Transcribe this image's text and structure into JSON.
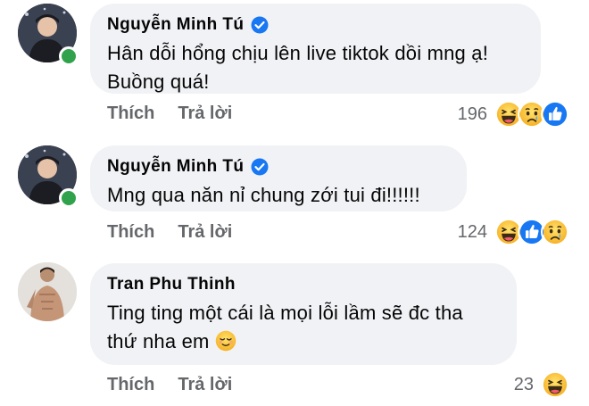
{
  "comments": [
    {
      "author": "Nguyễn Minh Tú",
      "verified": true,
      "text_lines": [
        "Hân dỗi hổng chịu lên live tiktok dồi mng ạ!",
        "Buồng quá!"
      ],
      "actions": {
        "like": "Thích",
        "reply": "Trả lời"
      },
      "reaction_count": "196",
      "reactions": [
        "haha-icon",
        "sad-icon",
        "like-icon"
      ],
      "online": true
    },
    {
      "author": "Nguyễn Minh Tú",
      "verified": true,
      "text_lines": [
        "Mng qua năn nỉ chung zới tui đi!!!!!!"
      ],
      "actions": {
        "like": "Thích",
        "reply": "Trả lời"
      },
      "reaction_count": "124",
      "reactions": [
        "haha-icon",
        "like-icon",
        "sad-icon"
      ],
      "online": true
    },
    {
      "author": "Tran Phu Thinh",
      "verified": false,
      "text_lines": [
        "Ting ting một cái là mọi lỗi lầm sẽ đc tha",
        "thứ nha em"
      ],
      "text_emoji": "relieved-face-icon",
      "actions": {
        "like": "Thích",
        "reply": "Trả lời"
      },
      "reaction_count": "23",
      "reactions": [
        "haha-icon"
      ],
      "online": false
    }
  ],
  "colors": {
    "bubble": "#f0f2f5",
    "action_text": "#65676b",
    "verified": "#1877f2",
    "online": "#31a24c"
  }
}
